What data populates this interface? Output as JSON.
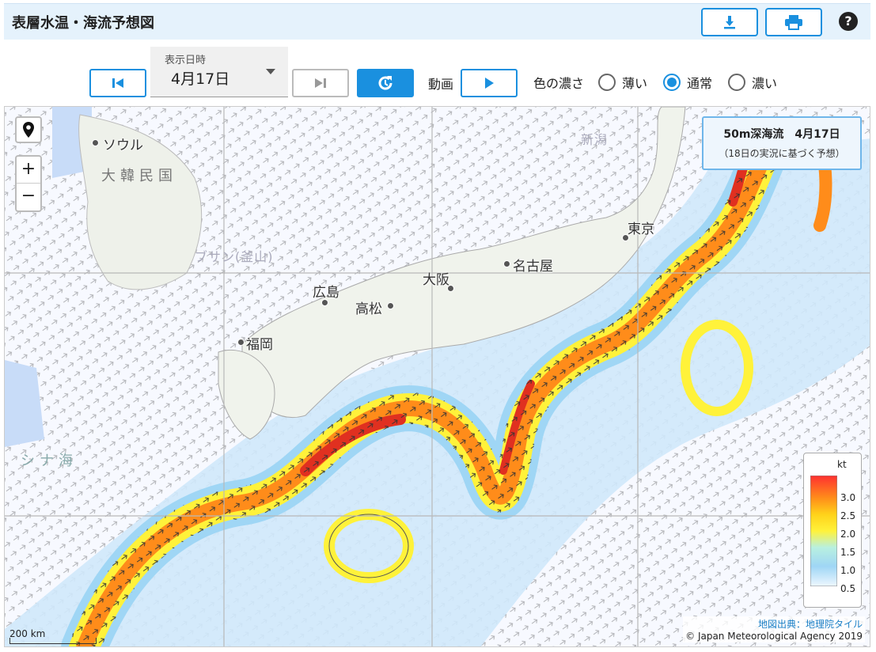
{
  "header": {
    "title": "表層水温・海流予想図",
    "download_icon": "download-icon",
    "print_icon": "print-icon",
    "help_label": "?"
  },
  "controls": {
    "date_label": "表示日時",
    "date_value": "4月17日",
    "animation_label": "動画",
    "density_label": "色の濃さ",
    "density_options": [
      "薄い",
      "通常",
      "濃い"
    ],
    "density_selected": "通常"
  },
  "map": {
    "info_title": "50m深海流　4月17日",
    "info_subtitle": "（18日の実況に基づく予想）",
    "zoom_in": "+",
    "zoom_out": "−",
    "cities": [
      "ソウル",
      "福岡",
      "広島",
      "高松",
      "大阪",
      "名古屋",
      "東京"
    ],
    "region_label": "大韓民国",
    "sea_label": "シナ海",
    "faint_labels": [
      "ブサン(釜山)",
      "新潟"
    ],
    "scale_label": "200 km",
    "credit_source": "地図出典：地理院タイル",
    "credit_copyright": "© Japan Meteorological Agency 2019"
  },
  "legend": {
    "unit": "kt",
    "ticks": [
      "3.0",
      "2.5",
      "2.0",
      "1.5",
      "1.0",
      "0.5"
    ],
    "colors": [
      "#ff3030",
      "#ff8c1a",
      "#ffd21a",
      "#fff23a",
      "#b8f0e0",
      "#9fd6f5",
      "#eef7ff"
    ]
  }
}
